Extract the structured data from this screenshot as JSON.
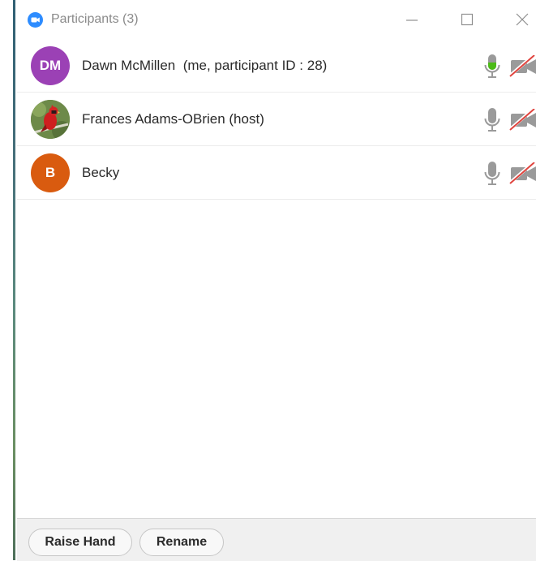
{
  "window": {
    "title": "Participants (3)"
  },
  "participants": [
    {
      "avatar_initials": "DM",
      "avatar_color": "#9b41b5",
      "name": "Dawn McMillen  (me, participant ID : 28)",
      "mic_state": "speaking",
      "video_state": "off"
    },
    {
      "avatar_initials": "",
      "avatar_color": "#6d8a49",
      "avatar_icon": "cardinal-bird-photo",
      "name": "Frances Adams-OBrien (host)",
      "mic_state": "on",
      "video_state": "off"
    },
    {
      "avatar_initials": "B",
      "avatar_color": "#d95b0f",
      "name": "Becky",
      "mic_state": "on",
      "video_state": "off"
    }
  ],
  "footer": {
    "raise_hand_label": "Raise Hand",
    "rename_label": "Rename"
  },
  "colors": {
    "accent": "#2d8cff",
    "mic_active": "#4cbb17",
    "video_off_slash": "#e0443e"
  }
}
